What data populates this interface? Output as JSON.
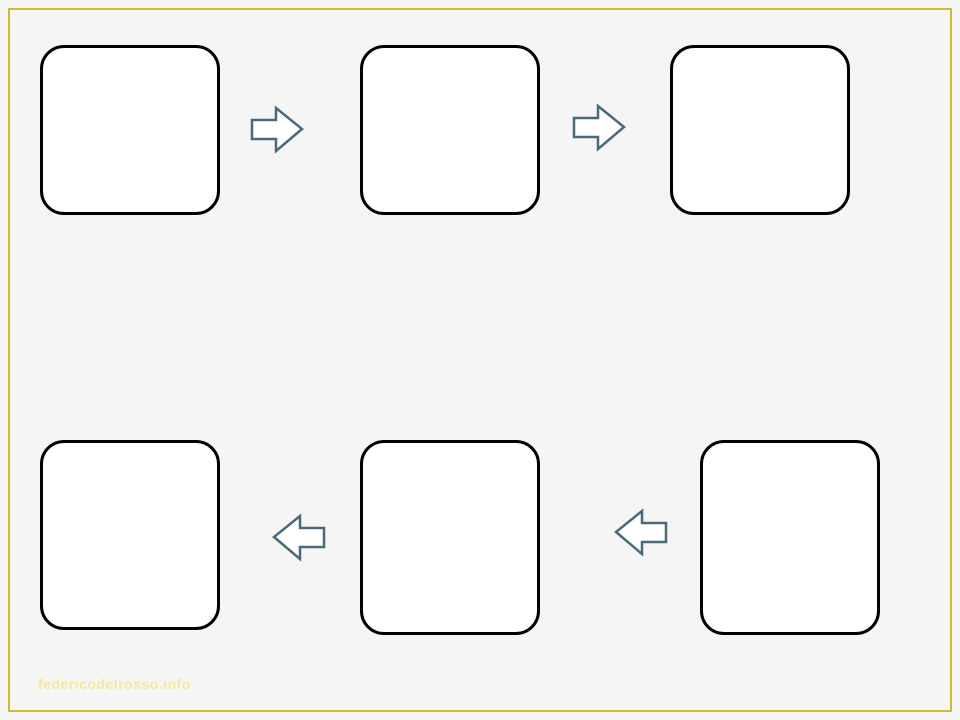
{
  "diagram": {
    "boxes": [
      {
        "id": "box1",
        "content": ""
      },
      {
        "id": "box2",
        "content": ""
      },
      {
        "id": "box3",
        "content": ""
      },
      {
        "id": "box4",
        "content": ""
      },
      {
        "id": "box5",
        "content": ""
      },
      {
        "id": "box6",
        "content": ""
      }
    ],
    "arrows": [
      {
        "id": "arr1",
        "direction": "right"
      },
      {
        "id": "arr2",
        "direction": "right"
      },
      {
        "id": "arr3",
        "direction": "left"
      },
      {
        "id": "arr4",
        "direction": "left"
      }
    ]
  },
  "watermark": "federicodelrosso.info"
}
